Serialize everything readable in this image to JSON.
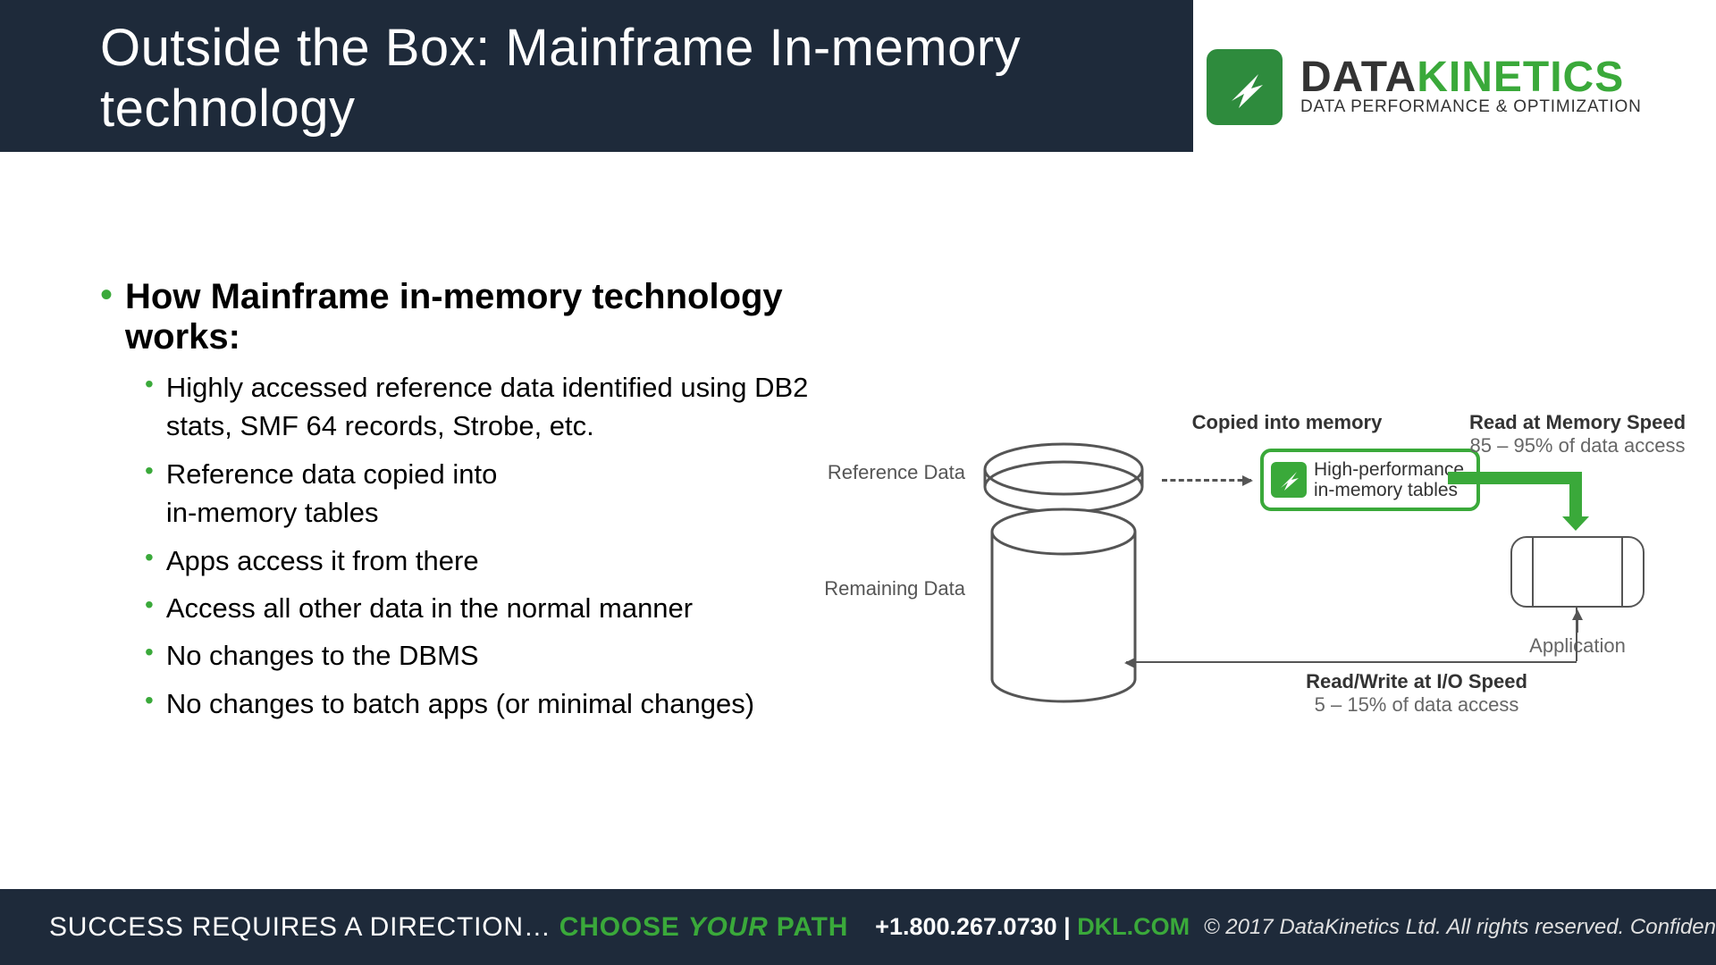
{
  "slide_title": "Outside the Box: Mainframe In-memory technology",
  "logo": {
    "word1": "DATA",
    "word2": "KINETICS",
    "tagline": "DATA PERFORMANCE & OPTIMIZATION"
  },
  "heading": "How Mainframe in-memory technology works:",
  "bullets": [
    "Highly accessed reference data identified using DB2 stats, SMF 64 records, Strobe, etc.",
    "Reference data copied into in-memory tables",
    "Apps access it from there",
    "Access all other data in the normal manner",
    "No changes to the DBMS",
    "No changes to batch apps (or minimal changes)"
  ],
  "diagram": {
    "reference_data": "Reference Data",
    "remaining_data": "Remaining Data",
    "copied": "Copied into memory",
    "mem_box_l1": "High-performance",
    "mem_box_l2": "in-memory tables",
    "read_mem": "Read at Memory Speed",
    "read_mem_sub": "85 – 95% of data access",
    "application": "Application",
    "rw_io": "Read/Write at I/O Speed",
    "rw_io_sub": "5 – 15% of data access"
  },
  "footer": {
    "direction": "SUCCESS REQUIRES A DIRECTION… ",
    "choose": "CHOOSE ",
    "your": "YOUR",
    "path": " PATH",
    "phone": "+1.800.267.0730  |  ",
    "dkl": "DKL.COM",
    "copyright": "© 2017 DataKinetics Ltd.   All rights reserved.  Confiden"
  }
}
